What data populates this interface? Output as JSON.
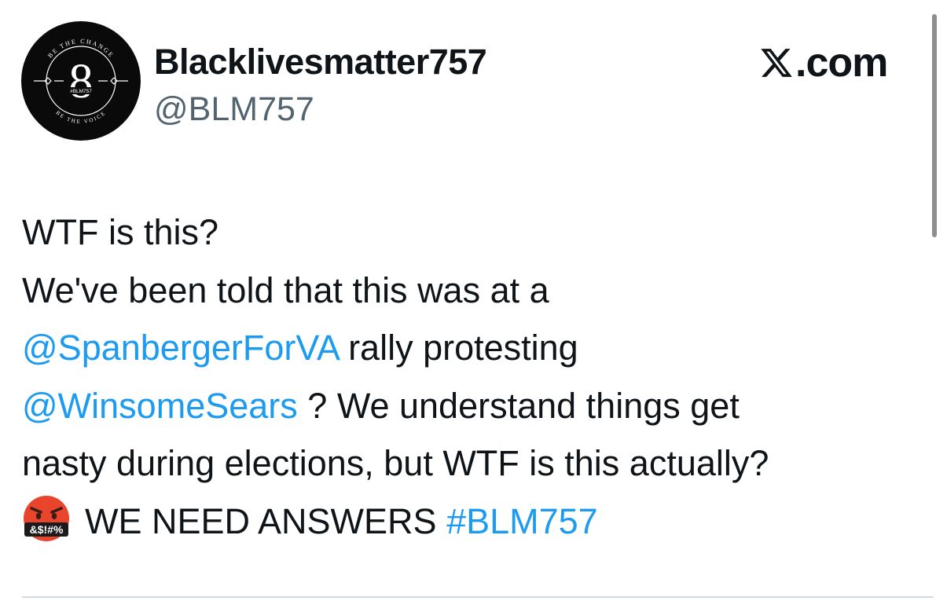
{
  "author": {
    "display_name": "Blacklivesmatter757",
    "handle": "@BLM757",
    "avatar": {
      "numeral": "8",
      "top_arc_text": "BE THE CHANGE",
      "bottom_arc_text": "BE THE VOICE",
      "center_tag": "#BLM757"
    }
  },
  "source": {
    "logo_icon": "x-logo-icon",
    "domain": ".com"
  },
  "tweet": {
    "line1": "WTF is this?",
    "line2": "We've been told that this was at a",
    "mention1": "@SpanbergerForVA",
    "line3_rest": " rally protesting",
    "mention2": "@WinsomeSears",
    "line4_rest": " ? We understand things get",
    "line5": "nasty during elections, but WTF is this actually?",
    "emoji": "face-with-symbols-on-mouth-emoji",
    "emoji_symbols": "&$!#%",
    "line6_text": "WE NEED ANSWERS ",
    "hashtag": "#BLM757"
  },
  "colors": {
    "link": "#1d9bf0",
    "text": "#0f1419",
    "secondary": "#536471"
  }
}
